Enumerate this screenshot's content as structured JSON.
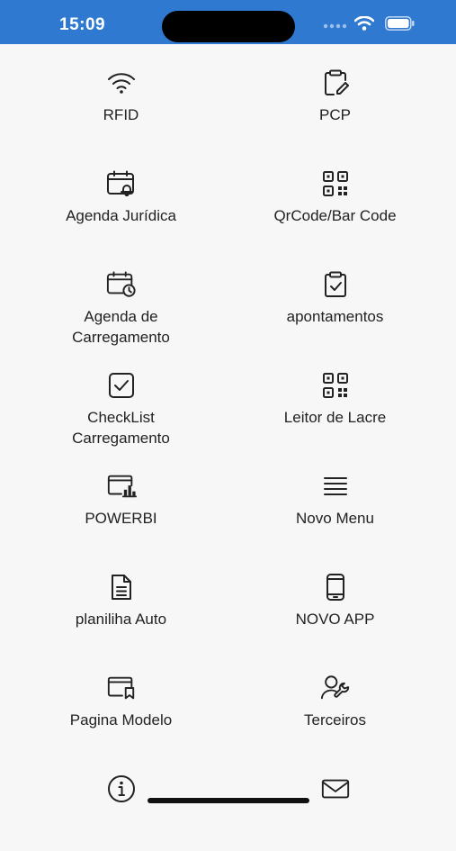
{
  "status": {
    "time": "15:09"
  },
  "menu": [
    {
      "label": "RFID",
      "icon": "wifi-icon"
    },
    {
      "label": "PCP",
      "icon": "clipboard-edit-icon"
    },
    {
      "label": "Agenda Jurídica",
      "icon": "calendar-bell-icon"
    },
    {
      "label": "QrCode/Bar Code",
      "icon": "qrcode-icon"
    },
    {
      "label": "Agenda de\nCarregamento",
      "icon": "calendar-clock-icon"
    },
    {
      "label": "apontamentos",
      "icon": "clipboard-check-icon"
    },
    {
      "label": "CheckList\nCarregamento",
      "icon": "checkbox-icon"
    },
    {
      "label": "Leitor de Lacre",
      "icon": "qrcode-icon"
    },
    {
      "label": "POWERBI",
      "icon": "chart-window-icon"
    },
    {
      "label": "Novo Menu",
      "icon": "menu-lines-icon"
    },
    {
      "label": "planiliha Auto",
      "icon": "document-icon"
    },
    {
      "label": "NOVO APP",
      "icon": "phone-icon"
    },
    {
      "label": "Pagina Modelo",
      "icon": "window-bookmark-icon"
    },
    {
      "label": "Terceiros",
      "icon": "user-wrench-icon"
    },
    {
      "label": "",
      "icon": "info-icon"
    },
    {
      "label": "",
      "icon": "mail-icon"
    }
  ]
}
